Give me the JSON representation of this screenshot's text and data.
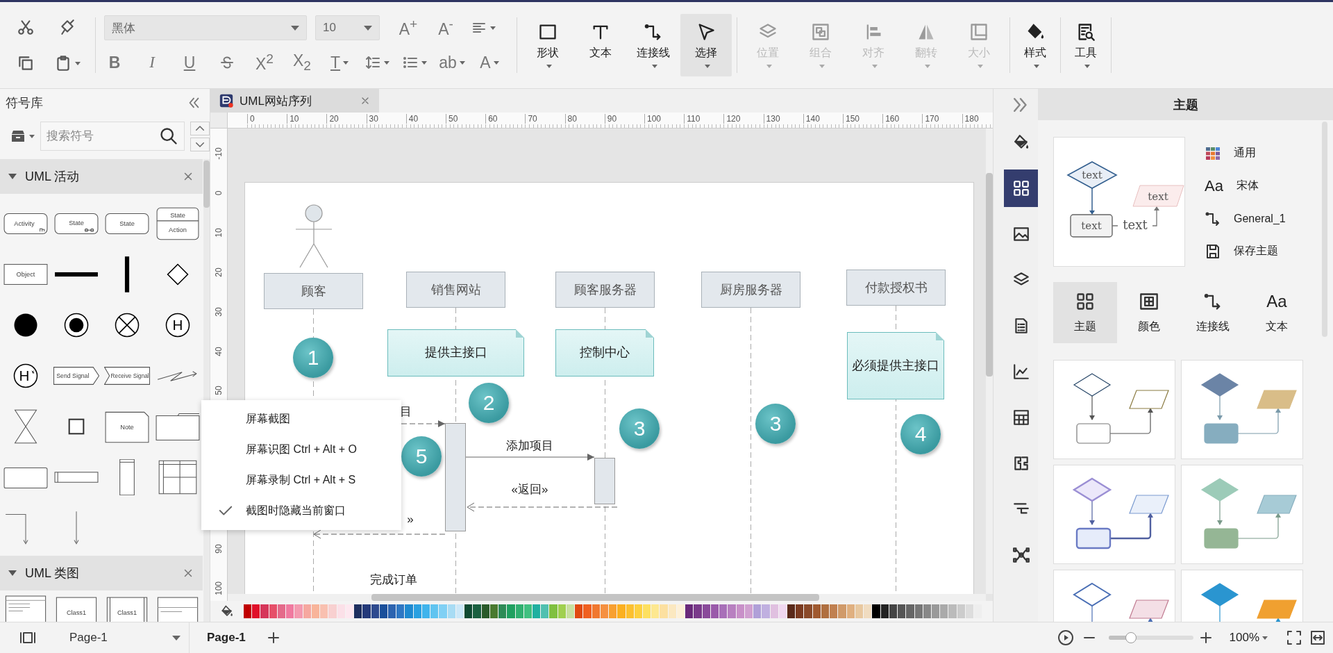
{
  "toolbar": {
    "font": "黑体",
    "font_size": "10",
    "row1": [
      {
        "kind": "plain",
        "glyph": "A$^{+}$",
        "dropdown": false
      },
      {
        "kind": "plain",
        "glyph": "A$^{-}$",
        "dropdown": false
      },
      {
        "kind": "align",
        "dropdown": true
      }
    ],
    "row2": [
      {
        "kind": "bold",
        "glyph": "B",
        "dropdown": false
      },
      {
        "kind": "italic",
        "glyph": "I",
        "dropdown": false
      },
      {
        "kind": "underline",
        "glyph": "U",
        "dropdown": false
      },
      {
        "kind": "strike",
        "dropdown": false
      },
      {
        "kind": "plain",
        "glyph": "X$^{2}$",
        "dropdown": false
      },
      {
        "kind": "plain",
        "glyph": "X$_{2}$",
        "dropdown": false
      },
      {
        "kind": "underline",
        "glyph": "T",
        "dropdown": true
      },
      {
        "kind": "line-spacing",
        "dropdown": true
      },
      {
        "kind": "list",
        "dropdown": true
      },
      {
        "kind": "plain",
        "glyph": "ab",
        "dropdown": true
      },
      {
        "kind": "plain",
        "glyph": "A",
        "dropdown": true
      }
    ],
    "tools": [
      {
        "label": "形状",
        "kind": "shape",
        "selected": false,
        "disabled": false,
        "dropdown": true
      },
      {
        "label": "文本",
        "kind": "text",
        "selected": false,
        "disabled": false,
        "dropdown": false
      },
      {
        "label": "连接线",
        "kind": "connector",
        "selected": false,
        "disabled": false,
        "dropdown": true
      },
      {
        "label": "选择",
        "kind": "select",
        "selected": true,
        "disabled": false,
        "dropdown": true
      },
      {
        "label": "位置",
        "kind": "position",
        "selected": false,
        "disabled": true,
        "dropdown": true
      },
      {
        "label": "组合",
        "kind": "group",
        "selected": false,
        "disabled": true,
        "dropdown": true
      },
      {
        "label": "对齐",
        "kind": "align",
        "selected": false,
        "disabled": true,
        "dropdown": true
      },
      {
        "label": "翻转",
        "kind": "flip",
        "selected": false,
        "disabled": true,
        "dropdown": true
      },
      {
        "label": "大小",
        "kind": "size",
        "selected": false,
        "disabled": true,
        "dropdown": true
      },
      {
        "label": "样式",
        "kind": "style",
        "selected": false,
        "disabled": false,
        "dropdown": true
      },
      {
        "label": "工具",
        "kind": "tools",
        "selected": false,
        "disabled": false,
        "dropdown": true
      }
    ]
  },
  "symbol_library": {
    "title": "符号库",
    "search": {
      "placeholder": "搜索符号"
    },
    "sections": [
      {
        "title": "UML 活动",
        "expanded": true,
        "shapes": [
          {
            "kind": "activity",
            "label": "Activity"
          },
          {
            "kind": "state-sub",
            "label": "State"
          },
          {
            "kind": "state",
            "label": "State"
          },
          {
            "kind": "state-action",
            "label": "State",
            "label_2": "Action"
          },
          {
            "kind": "object",
            "label": "Object"
          },
          {
            "kind": "hbar"
          },
          {
            "kind": "vbar"
          },
          {
            "kind": "decision"
          },
          {
            "kind": "initial"
          },
          {
            "kind": "final"
          },
          {
            "kind": "flow-final"
          },
          {
            "kind": "history",
            "label": "H"
          },
          {
            "kind": "deep-history",
            "label": "H"
          },
          {
            "kind": "send-signal",
            "label": "Send Signal"
          },
          {
            "kind": "receive-signal",
            "label": "Receive Signal"
          },
          {
            "kind": "lightning"
          },
          {
            "kind": "hourglass"
          },
          {
            "kind": "square"
          },
          {
            "kind": "note",
            "label": "Note"
          },
          {
            "kind": "frame"
          },
          {
            "kind": "box"
          },
          {
            "kind": "narrow-box"
          },
          {
            "kind": "lane"
          },
          {
            "kind": "swimlane"
          },
          {
            "kind": "elbow-arrow"
          },
          {
            "kind": "arrow"
          }
        ]
      },
      {
        "title": "UML 类图",
        "expanded": true,
        "shapes": [
          {
            "kind": "class-attr"
          },
          {
            "kind": "class",
            "label": "Class1"
          },
          {
            "kind": "class-lane",
            "label": "Class1"
          },
          {
            "kind": "interface"
          }
        ]
      }
    ]
  },
  "document_tab": {
    "title": "UML网站序列"
  },
  "ruler_h": [
    "0",
    "10",
    "20",
    "30",
    "40",
    "50",
    "60",
    "70",
    "80",
    "90",
    "100",
    "110",
    "120",
    "130",
    "140",
    "150",
    "160",
    "170",
    "180"
  ],
  "ruler_v": [
    "-10",
    "0",
    "10",
    "20",
    "30",
    "40",
    "50",
    "90",
    "100"
  ],
  "diagram": {
    "lifelines": [
      {
        "label": "顾客"
      },
      {
        "label": "销售网站"
      },
      {
        "label": "顾客服务器"
      },
      {
        "label": "厨房服务器"
      },
      {
        "label": "付款授权书"
      }
    ],
    "notes": [
      {
        "text": "提供主接口"
      },
      {
        "text": "控制中心"
      },
      {
        "text": "必须提供主接口"
      }
    ],
    "steps": [
      {
        "number": "1"
      },
      {
        "number": "2"
      },
      {
        "number": "3"
      },
      {
        "number": "3"
      },
      {
        "number": "4"
      },
      {
        "number": "5"
      }
    ],
    "messages": [
      {
        "label": "目",
        "kind": "async"
      },
      {
        "label": "添加项目",
        "kind": "call"
      },
      {
        "label": "«返回»",
        "kind": "return"
      },
      {
        "label": "»",
        "kind": "return"
      }
    ],
    "bottom_label": "完成订单"
  },
  "context_menu": [
    {
      "label": "屏幕截图",
      "checked": false
    },
    {
      "label": "屏幕识图 Ctrl + Alt + O",
      "checked": false
    },
    {
      "label": "屏幕录制 Ctrl + Alt + S",
      "checked": false
    },
    {
      "label": "截图时隐藏当前窗口",
      "checked": true
    }
  ],
  "side_icons": [
    {
      "kind": "fill",
      "selected": false
    },
    {
      "kind": "theme",
      "selected": true
    },
    {
      "kind": "image",
      "selected": false
    },
    {
      "kind": "layers",
      "selected": false
    },
    {
      "kind": "outline",
      "selected": false
    },
    {
      "kind": "chart",
      "selected": false
    },
    {
      "kind": "table",
      "selected": false
    },
    {
      "kind": "puzzle",
      "selected": false
    },
    {
      "kind": "gantt",
      "selected": false
    },
    {
      "kind": "mindmap",
      "selected": false
    }
  ],
  "theme_panel": {
    "title": "主题",
    "preview_labels": [
      "text",
      "text",
      "text",
      "text"
    ],
    "options": [
      {
        "kind": "palette",
        "label": "通用"
      },
      {
        "kind": "font",
        "icon_text": "Aa",
        "label": "宋体"
      },
      {
        "kind": "connector",
        "label": "General_1"
      },
      {
        "kind": "save",
        "label": "保存主题"
      }
    ],
    "tabs": [
      {
        "kind": "theme",
        "label": "主题",
        "selected": true
      },
      {
        "kind": "color",
        "label": "颜色",
        "selected": false
      },
      {
        "kind": "connector",
        "label": "连接线",
        "selected": false
      },
      {
        "kind": "font",
        "icon_text": "Aa",
        "label": "文本",
        "selected": false
      }
    ]
  },
  "status_bar": {
    "page_select": "Page-1",
    "pages": [
      {
        "label": "Page-1",
        "selected": true
      }
    ],
    "zoom": {
      "level": 0.27,
      "value": "100%"
    }
  }
}
